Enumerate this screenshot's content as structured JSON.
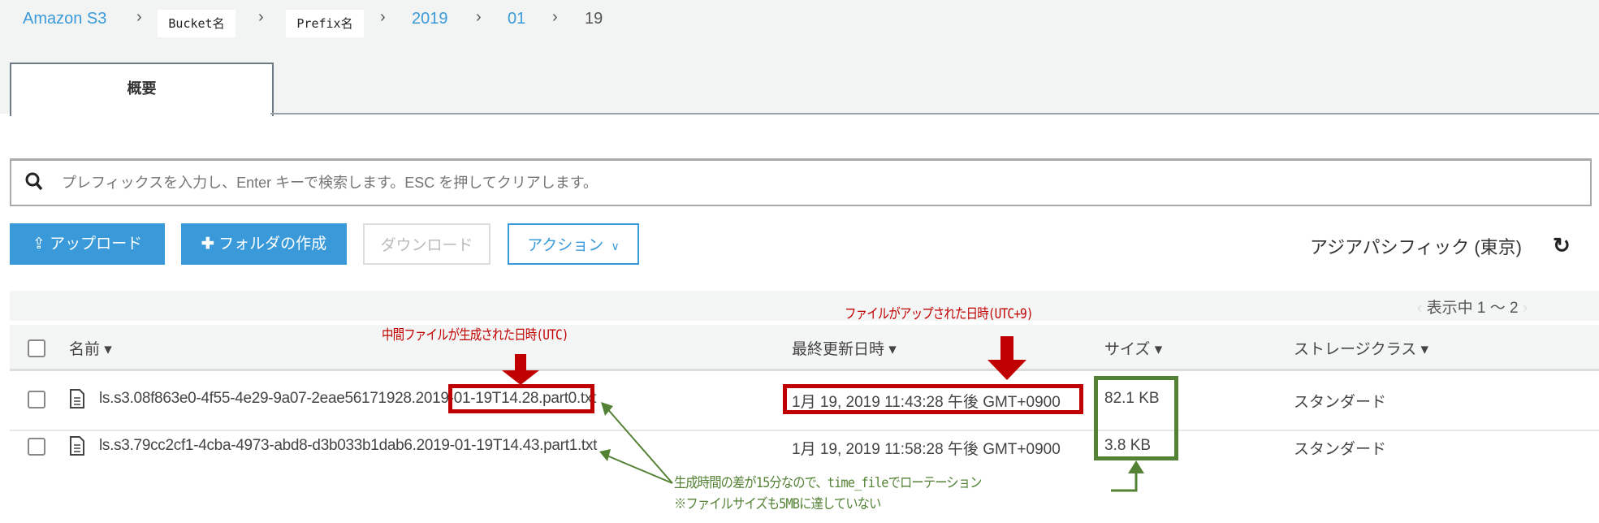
{
  "breadcrumb": {
    "root": "Amazon S3",
    "bucket": "Bucket名",
    "prefix": "Prefix名",
    "year": "2019",
    "month": "01",
    "day": "19",
    "separator": "›"
  },
  "tabs": [
    {
      "label": "概要"
    }
  ],
  "search": {
    "placeholder": "プレフィックスを入力し、Enter キーで検索します。ESC を押してクリアします。"
  },
  "toolbar": {
    "upload": "アップロード",
    "create_folder": "フォルダの作成",
    "download": "ダウンロード",
    "actions": "アクション",
    "region": "アジアパシフィック (東京)"
  },
  "pager": {
    "text": "表示中 1 ～ 2"
  },
  "table": {
    "headers": {
      "name": "名前",
      "modified": "最終更新日時",
      "size": "サイズ",
      "storage": "ストレージクラス"
    },
    "rows": [
      {
        "name_prefix": "ls.s3.08f863e0-4f55-4e29-9a07-2eae56171928.",
        "name_date": "2019-01-19T14.28",
        "name_suffix": ".part0.txt",
        "modified": "1月 19, 2019 11:43:28 午後 GMT+0900",
        "size": "82.1 KB",
        "storage": "スタンダード"
      },
      {
        "name_prefix": "ls.s3.79cc2cf1-4cba-4973-abd8-d3b033b1dab6.",
        "name_date": "2019-01-19T14.43",
        "name_suffix": ".part1.txt",
        "modified": "1月 19, 2019 11:58:28 午後 GMT+0900",
        "size": "3.8 KB",
        "storage": "スタンダード"
      }
    ]
  },
  "annotations": {
    "intermediate_file_label": "中間ファイルが生成された日時(UTC)",
    "upload_label": "ファイルがアップされた日時(UTC+9)",
    "note_line1": "生成時間の差が15分なので、time_fileでローテーション",
    "note_line2": "※ファイルサイズも5MBに達していない",
    "red": "#c00000",
    "green": "#548235"
  }
}
